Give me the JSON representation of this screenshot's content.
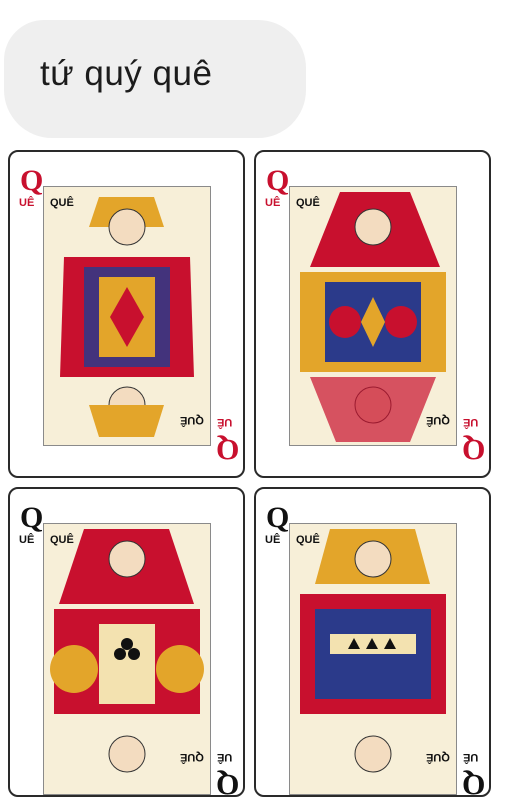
{
  "message": {
    "text": "tứ quý quê"
  },
  "cards": [
    {
      "rank": "Q",
      "suit_label": "UÊ",
      "art_label": "QUÊ",
      "suit": "diamond",
      "color": "#c8102e"
    },
    {
      "rank": "Q",
      "suit_label": "UÊ",
      "art_label": "QUÊ",
      "suit": "heart",
      "color": "#c8102e"
    },
    {
      "rank": "Q",
      "suit_label": "UÊ",
      "art_label": "QUÊ",
      "suit": "club",
      "color": "#111111"
    },
    {
      "rank": "Q",
      "suit_label": "UÊ",
      "art_label": "QUÊ",
      "suit": "spade",
      "color": "#111111"
    }
  ],
  "colors": {
    "red": "#c8102e",
    "gold": "#e3a52a",
    "navy": "#2b3a8a",
    "bubble": "#efefef"
  }
}
